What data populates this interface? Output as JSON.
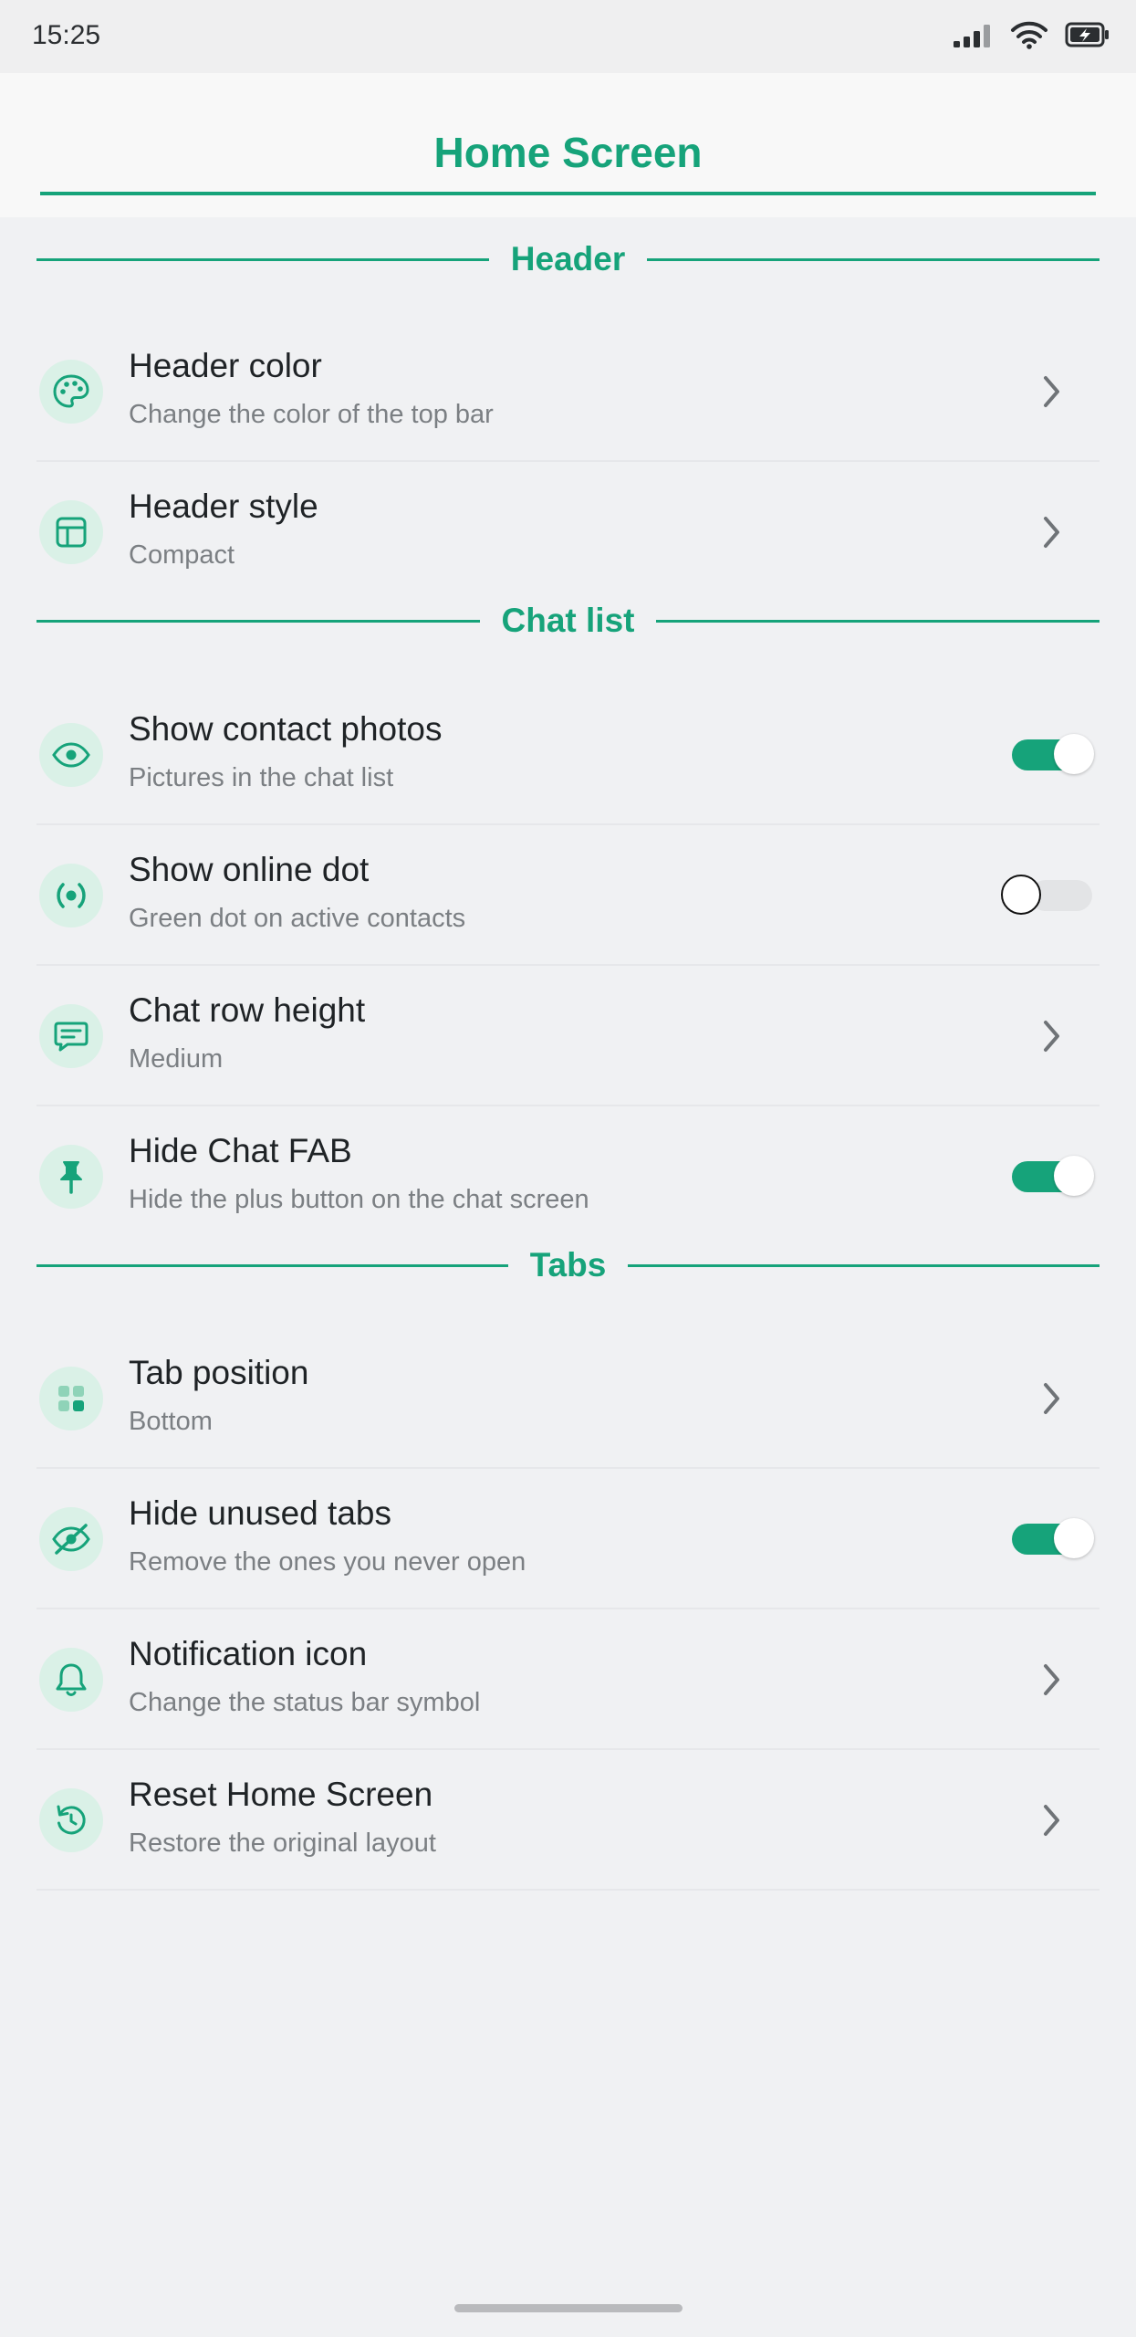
{
  "status_bar": {
    "time": "15:25",
    "icons": [
      "signal-icon",
      "wifi-icon",
      "battery-charging-icon"
    ]
  },
  "header": {
    "title": "Home Screen"
  },
  "sections": [
    {
      "label": "Header",
      "rows": [
        {
          "title": "Header color",
          "subtitle": "Change the color of the top bar",
          "icon": "palette-icon",
          "control": "chevron"
        },
        {
          "title": "Header style",
          "subtitle": "Compact",
          "icon": "layout-icon",
          "control": "chevron"
        }
      ]
    },
    {
      "label": "Chat list",
      "rows": [
        {
          "title": "Show contact photos",
          "subtitle": "Pictures in the chat list",
          "icon": "eye-icon",
          "control": "toggle",
          "toggle_on": true
        },
        {
          "title": "Show online dot",
          "subtitle": "Green dot on active contacts",
          "icon": "online-dot-icon",
          "control": "toggle",
          "toggle_on": false
        },
        {
          "title": "Chat row height",
          "subtitle": "Medium",
          "icon": "chat-bubble-icon",
          "control": "chevron"
        },
        {
          "title": "Hide Chat FAB",
          "subtitle": "Hide the plus button on the chat screen",
          "icon": "pin-icon",
          "control": "toggle",
          "toggle_on": true
        }
      ]
    },
    {
      "label": "Tabs",
      "rows": [
        {
          "title": "Tab position",
          "subtitle": "Bottom",
          "icon": "grid-icon",
          "control": "chevron"
        },
        {
          "title": "Hide unused tabs",
          "subtitle": "Remove the ones you never open",
          "icon": "eye-off-icon",
          "control": "toggle",
          "toggle_on": true
        },
        {
          "title": "Notification icon",
          "subtitle": "Change the status bar symbol",
          "icon": "bell-icon",
          "control": "chevron"
        },
        {
          "title": "Reset Home Screen",
          "subtitle": "Restore the original layout",
          "icon": "reset-icon",
          "control": "chevron"
        }
      ]
    }
  ],
  "colors": {
    "accent": "#16a37a",
    "icon_bg": "#daf1e7",
    "background": "#f0f1f3"
  }
}
